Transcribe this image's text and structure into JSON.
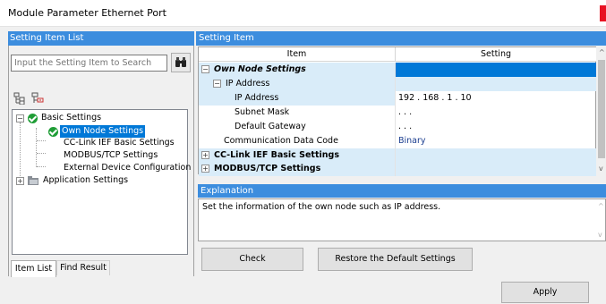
{
  "window": {
    "title": "Module Parameter Ethernet Port",
    "accent_color": "#3c8dde",
    "selection_color": "#0078d7"
  },
  "left_panel": {
    "header": "Setting Item List",
    "search_placeholder": "Input the Setting Item to Search",
    "search_icon": "binoculars-icon",
    "toolbar_icons": [
      "expand-all-icon",
      "collapse-all-icon"
    ],
    "tree": [
      {
        "label": "Basic Settings",
        "icon": "check-icon"
      },
      {
        "label": "Own Node Settings",
        "icon": "check-icon"
      },
      {
        "label": "CC-Link IEF Basic Settings"
      },
      {
        "label": "MODBUS/TCP Settings"
      },
      {
        "label": "External Device Configuration"
      },
      {
        "label": "Application Settings",
        "icon": "folder-icon"
      }
    ],
    "tabs": [
      "Item List",
      "Find Result"
    ]
  },
  "right_panel": {
    "header": "Setting Item",
    "columns": [
      "Item",
      "Setting"
    ],
    "rows": [
      {
        "item": "Own Node Settings",
        "setting": ""
      },
      {
        "item": "IP Address",
        "setting": ""
      },
      {
        "item": "IP Address",
        "setting": "192 . 168 .  1 . 10"
      },
      {
        "item": "Subnet Mask",
        "setting": "  .      .      ."
      },
      {
        "item": "Default Gateway",
        "setting": "  .      .      ."
      },
      {
        "item": "Communication Data Code",
        "setting": "Binary"
      },
      {
        "item": "CC-Link IEF Basic Settings",
        "setting": ""
      },
      {
        "item": "MODBUS/TCP Settings",
        "setting": ""
      }
    ]
  },
  "explanation": {
    "header": "Explanation",
    "text": "Set the information of the own node such as IP address."
  },
  "buttons": {
    "check": "Check",
    "restore": "Restore the Default Settings",
    "apply": "Apply"
  }
}
